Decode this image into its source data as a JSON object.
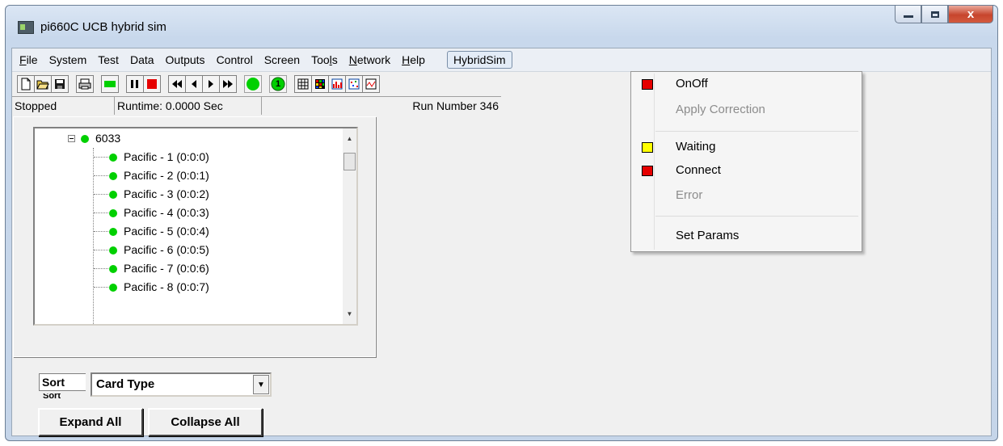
{
  "window": {
    "title": "pi660C UCB hybrid sim",
    "controls": {
      "close_glyph": "x"
    }
  },
  "menubar": {
    "items": [
      {
        "label": "File",
        "accel": "F",
        "rest": "ile"
      },
      {
        "label": "System"
      },
      {
        "label": "Test"
      },
      {
        "label": "Data"
      },
      {
        "label": "Outputs"
      },
      {
        "label": "Control"
      },
      {
        "label": "Screen"
      },
      {
        "label": "Tools",
        "pre": "Too",
        "accel": "l",
        "rest": "s"
      },
      {
        "label": "Network",
        "accel": "N",
        "rest": "etwork"
      },
      {
        "label": "Help",
        "accel": "H",
        "rest": "elp"
      }
    ],
    "active": "HybridSim"
  },
  "toolbar": {
    "icons": [
      "new-file-icon",
      "open-folder-icon",
      "save-disk-icon",
      "print-icon",
      "run-green-icon",
      "pause-icon",
      "stop-red-icon",
      "rewind-icon",
      "step-back-icon",
      "step-forward-icon",
      "fast-forward-icon",
      "green-circle-icon",
      "numbered-one-icon",
      "grid-view-icon",
      "color-map-icon",
      "bar-graph-icon",
      "scatter-plot-icon",
      "strip-chart-icon"
    ],
    "one_badge": "1"
  },
  "status": {
    "state": "Stopped",
    "runtime": "Runtime: 0.0000 Sec",
    "run_number": "Run Number 346"
  },
  "tree": {
    "root": "6033",
    "children": [
      "Pacific - 1 (0:0:0)",
      "Pacific - 2 (0:0:1)",
      "Pacific - 3 (0:0:2)",
      "Pacific - 4 (0:0:3)",
      "Pacific - 5 (0:0:4)",
      "Pacific - 6 (0:0:5)",
      "Pacific - 7 (0:0:6)",
      "Pacific - 8 (0:0:7)"
    ]
  },
  "sort": {
    "label": "Sort",
    "selected": "Card Type",
    "clipped_label": "Sort"
  },
  "buttons": {
    "expand_all": "Expand All",
    "collapse_all": "Collapse All"
  },
  "dropdown": {
    "items": [
      {
        "label": "OnOff",
        "swatch": "#e60000",
        "enabled": true
      },
      {
        "label": "Apply Correction",
        "swatch": null,
        "enabled": false
      },
      {
        "label": "Waiting",
        "swatch": "#ffff00",
        "enabled": true
      },
      {
        "label": "Connect",
        "swatch": "#e60000",
        "enabled": true
      },
      {
        "label": "Error",
        "swatch": null,
        "enabled": false
      },
      {
        "label": "Set Params",
        "swatch": null,
        "enabled": true
      }
    ]
  },
  "colors": {
    "status_green": "#00d000",
    "stop_red": "#e60000",
    "waiting_yellow": "#ffff00"
  }
}
